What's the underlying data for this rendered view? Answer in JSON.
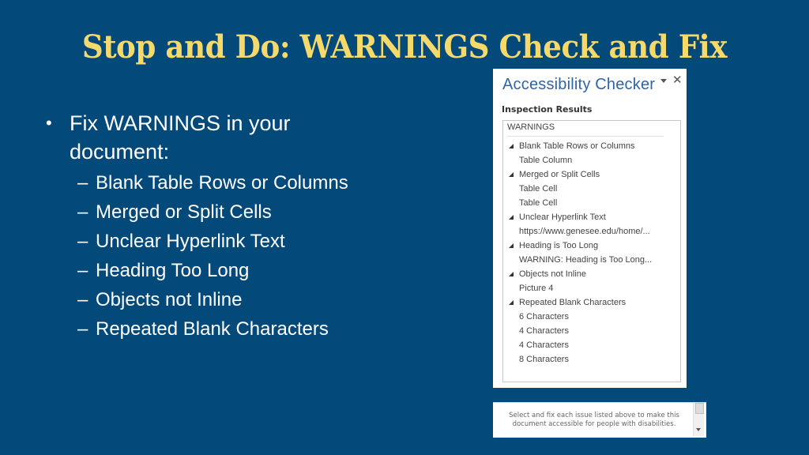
{
  "slide": {
    "title": "Stop and Do: WARNINGS Check and Fix",
    "bullet": {
      "marker": "•",
      "text": "Fix WARNINGS in your document:",
      "sub_marker": "–",
      "sub_items": [
        "Blank Table Rows or Columns",
        "Merged or Split Cells",
        "Unclear Hyperlink Text",
        "Heading Too Long",
        "Objects not Inline",
        "Repeated Blank Characters"
      ]
    }
  },
  "checker": {
    "title": "Accessibility Checker",
    "dropdown_icon": "chevron-down-icon",
    "close_icon": "✕",
    "inspection_label": "Inspection Results",
    "category": "WARNINGS",
    "results": [
      {
        "label": "Blank Table Rows or Columns",
        "type": "group"
      },
      {
        "label": "Table Column",
        "type": "item"
      },
      {
        "label": "Merged or Split Cells",
        "type": "group"
      },
      {
        "label": "Table Cell",
        "type": "item"
      },
      {
        "label": "Table Cell",
        "type": "item"
      },
      {
        "label": "Unclear Hyperlink Text",
        "type": "group"
      },
      {
        "label": "https://www.genesee.edu/home/...",
        "type": "item"
      },
      {
        "label": "Heading is Too Long",
        "type": "group"
      },
      {
        "label": "WARNING: Heading is Too Long...",
        "type": "item"
      },
      {
        "label": "Objects not Inline",
        "type": "group"
      },
      {
        "label": "Picture 4",
        "type": "item"
      },
      {
        "label": "Repeated Blank Characters",
        "type": "group"
      },
      {
        "label": "6 Characters",
        "type": "item"
      },
      {
        "label": "4 Characters",
        "type": "item"
      },
      {
        "label": "4 Characters",
        "type": "item"
      },
      {
        "label": "8 Characters",
        "type": "item"
      }
    ],
    "status_text": "Select and fix each issue listed above to make this document accessible for people with disabilities."
  },
  "colors": {
    "background": "#03497a",
    "title": "#f6d96b",
    "body_text": "#ffffff",
    "panel_title": "#2e64a8"
  }
}
